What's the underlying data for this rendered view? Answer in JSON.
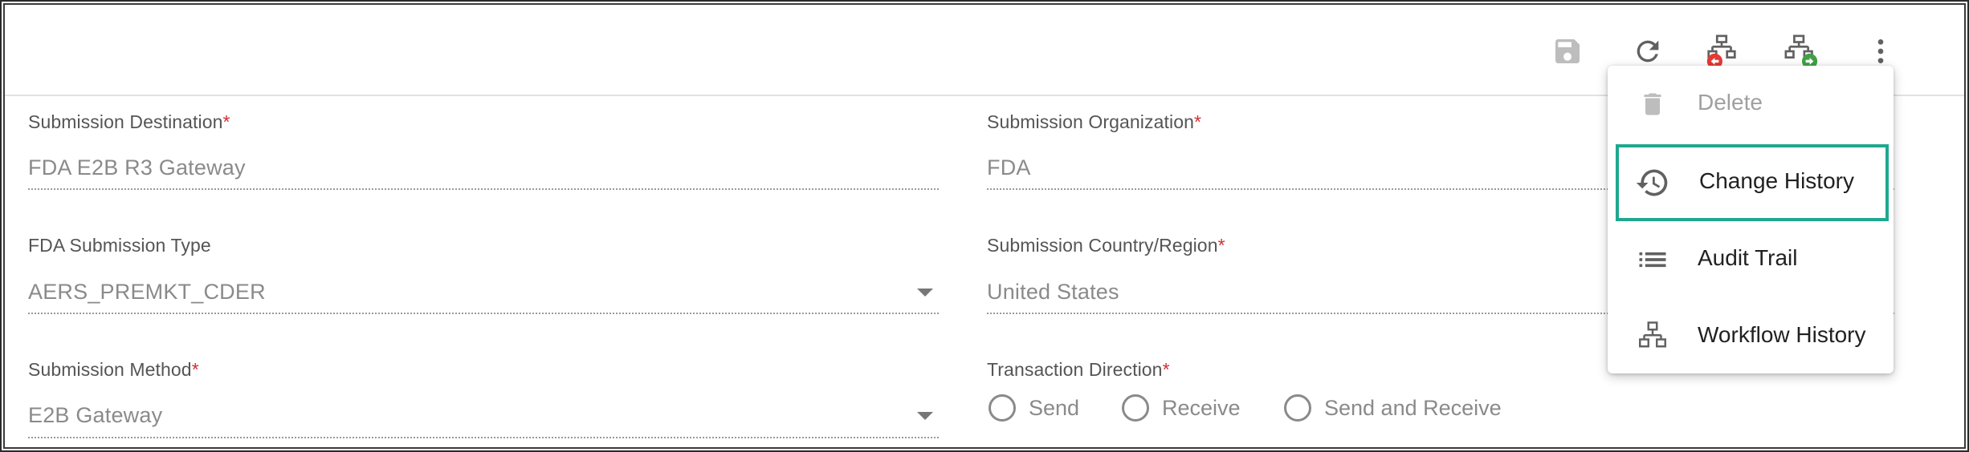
{
  "toolbar": {
    "icons": [
      "save-icon",
      "refresh-icon",
      "workflow-reject-icon",
      "workflow-forward-icon",
      "more-vert-icon"
    ]
  },
  "form": {
    "submission_destination": {
      "label": "Submission Destination",
      "required": "*",
      "value": "FDA E2B R3 Gateway"
    },
    "submission_organization": {
      "label": "Submission Organization",
      "required": "*",
      "value": "FDA"
    },
    "fda_submission_type": {
      "label": "FDA Submission Type",
      "value": "AERS_PREMKT_CDER"
    },
    "submission_country": {
      "label": "Submission Country/Region",
      "required": "*",
      "value": "United States"
    },
    "submission_method": {
      "label": "Submission Method",
      "required": "*",
      "value": "E2B Gateway"
    },
    "transaction_direction": {
      "label": "Transaction Direction",
      "required": "*",
      "options": [
        "Send",
        "Receive",
        "Send and Receive"
      ]
    }
  },
  "menu": {
    "items": [
      {
        "label": "Delete",
        "icon": "delete-icon",
        "state": "disabled"
      },
      {
        "label": "Change History",
        "icon": "history-icon",
        "state": "highlighted"
      },
      {
        "label": "Audit Trail",
        "icon": "list-icon",
        "state": "normal"
      },
      {
        "label": "Workflow History",
        "icon": "workflow-icon",
        "state": "normal"
      }
    ]
  },
  "colors": {
    "required": "#d32f2f",
    "highlight_border": "#1ea88f",
    "reject_badge": "#e53935",
    "forward_badge": "#43a047",
    "muted_text": "#8a8a8a"
  }
}
